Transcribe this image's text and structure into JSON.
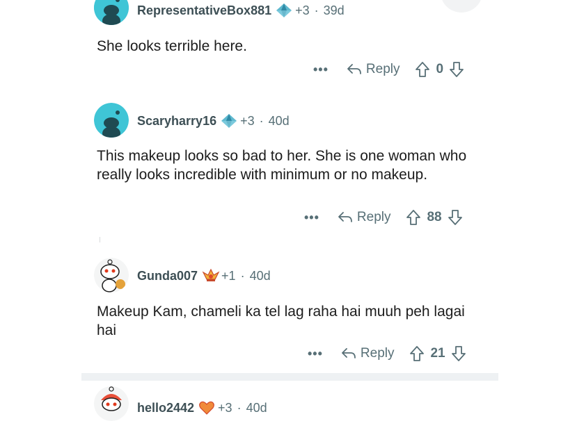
{
  "comments": [
    {
      "username": "RepresentativeBox881",
      "award_icon": "crystal-award-icon",
      "award_count": "+3",
      "age": "39d",
      "text": "She looks terrible here.",
      "more_label": "•••",
      "reply_label": "Reply",
      "votes": "0"
    },
    {
      "username": "Scaryharry16",
      "award_icon": "crystal-award-icon",
      "award_count": "+3",
      "age": "40d",
      "text": "This makeup looks so bad to her. She is one woman who really looks incredible with minimum or no makeup.",
      "more_label": "•••",
      "reply_label": "Reply",
      "votes": "88"
    },
    {
      "username": "Gunda007",
      "award_icon": "crown-award-icon",
      "award_count": "+1",
      "age": "40d",
      "text": "Makeup Kam, chameli ka tel lag raha hai muuh peh lagai hai",
      "more_label": "•••",
      "reply_label": "Reply",
      "votes": "21"
    },
    {
      "username": "hello2442",
      "award_icon": "heart-award-icon",
      "award_count": "+3",
      "age": "40d"
    }
  ],
  "separator": "·",
  "colors": {
    "avatar_teal": "#3fc5d6",
    "avatar_dark": "#1f4a52",
    "meta_gray": "#576f76",
    "divider": "#eef1f3"
  }
}
